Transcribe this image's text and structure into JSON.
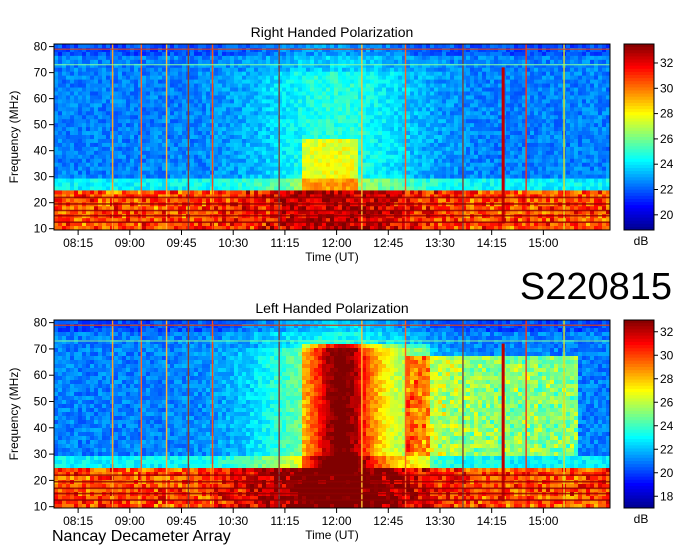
{
  "header": {
    "observation_id": "S220815",
    "instrument": "Nancay Decameter Array"
  },
  "chart_data": [
    {
      "type": "heatmap",
      "title": "Right Handed Polarization",
      "xlabel": "Time (UT)",
      "ylabel": "Frequency (MHz)",
      "x_ticks": [
        "08:15",
        "09:00",
        "09:45",
        "10:30",
        "11:15",
        "12:00",
        "12:45",
        "13:30",
        "14:15",
        "15:00"
      ],
      "x_range": [
        "07:54",
        "15:58"
      ],
      "y_ticks": [
        10,
        20,
        30,
        40,
        50,
        60,
        70,
        80
      ],
      "ylim": [
        9.5,
        81
      ],
      "colorbar": {
        "label": "dB",
        "ticks": [
          20,
          22,
          24,
          26,
          28,
          30,
          32
        ],
        "range": [
          18.8,
          33.5
        ]
      },
      "colormap": [
        "#00008f",
        "#0000ff",
        "#0080ff",
        "#00ffff",
        "#80ff80",
        "#ffff00",
        "#ff8000",
        "#ff0000",
        "#800000"
      ]
    },
    {
      "type": "heatmap",
      "title": "Left Handed Polarization",
      "xlabel": "Time (UT)",
      "ylabel": "Frequency (MHz)",
      "x_ticks": [
        "08:15",
        "09:00",
        "09:45",
        "10:30",
        "11:15",
        "12:00",
        "12:45",
        "13:30",
        "14:15",
        "15:00"
      ],
      "x_range": [
        "07:54",
        "15:58"
      ],
      "y_ticks": [
        10,
        20,
        30,
        40,
        50,
        60,
        70,
        80
      ],
      "ylim": [
        9.5,
        81
      ],
      "colorbar": {
        "label": "dB",
        "ticks": [
          18,
          20,
          22,
          24,
          26,
          28,
          30,
          32
        ],
        "range": [
          17,
          33
        ]
      },
      "colormap": [
        "#00008f",
        "#0000ff",
        "#0080ff",
        "#00ffff",
        "#80ff80",
        "#ffff00",
        "#ff8000",
        "#ff0000",
        "#800000"
      ]
    }
  ]
}
